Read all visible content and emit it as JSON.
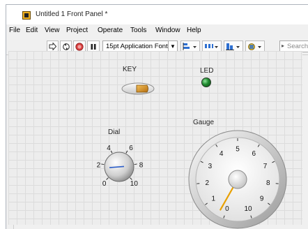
{
  "window": {
    "title": "Untitled 1 Front Panel *"
  },
  "menu": {
    "items": [
      "File",
      "Edit",
      "View",
      "Project",
      "Operate",
      "Tools",
      "Window",
      "Help"
    ]
  },
  "toolbar": {
    "font_ring": "15pt Application Font",
    "search_placeholder": "Search"
  },
  "front_panel": {
    "key": {
      "label": "KEY"
    },
    "led": {
      "label": "LED",
      "on": true,
      "color": "#1e8a2e"
    },
    "dial": {
      "label": "Dial",
      "ticks": [
        "0",
        "2",
        "4",
        "6",
        "8",
        "10"
      ],
      "value": 1.5
    },
    "gauge": {
      "label": "Gauge",
      "ticks": [
        "0",
        "1",
        "2",
        "3",
        "4",
        "5",
        "6",
        "7",
        "8",
        "9",
        "10"
      ],
      "value": 0.3,
      "needle_color": "#e8a000"
    }
  }
}
